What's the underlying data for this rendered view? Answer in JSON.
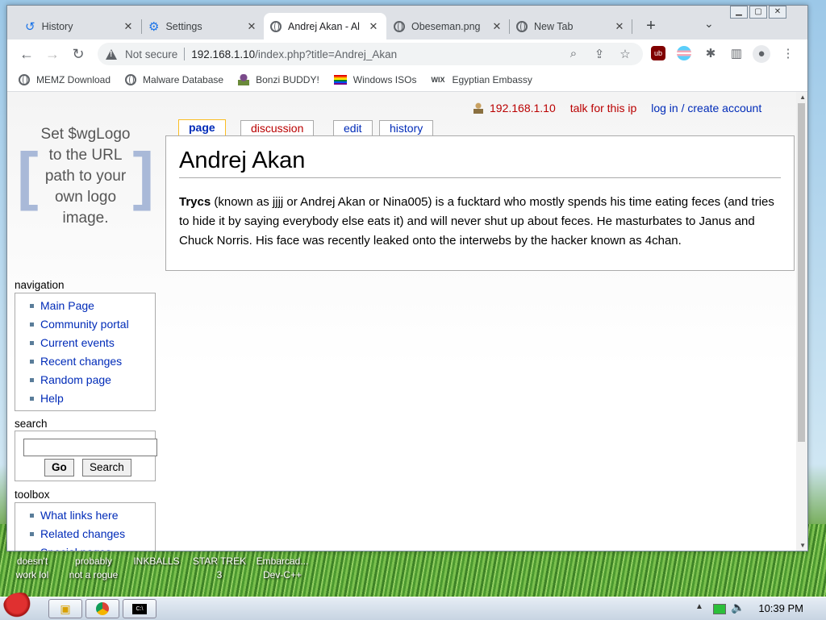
{
  "desktop": {
    "icons": [
      {
        "label_line1": "doesn't",
        "label_line2": "work lol"
      },
      {
        "label_line1": "probably",
        "label_line2": "not a rogue"
      },
      {
        "label_line1": "INKBALLS",
        "label_line2": ""
      },
      {
        "label_line1": "STAR TREK",
        "label_line2": "3"
      },
      {
        "label_line1": "Embarcad...",
        "label_line2": "Dev-C++"
      }
    ]
  },
  "browser": {
    "tabs": [
      {
        "title": "History",
        "icon": "history-icon"
      },
      {
        "title": "Settings",
        "icon": "gear-icon"
      },
      {
        "title": "Andrej Akan - Al",
        "icon": "globe-icon"
      },
      {
        "title": "Obeseman.png",
        "icon": "globe-icon"
      },
      {
        "title": "New Tab",
        "icon": "chrome-icon"
      }
    ],
    "security_label": "Not secure",
    "url_host": "192.168.1.10",
    "url_path": "/index.php?title=Andrej_Akan",
    "bookmarks": [
      {
        "label": "MEMZ Download",
        "icon": "globe-icon"
      },
      {
        "label": "Malware Database",
        "icon": "globe-icon"
      },
      {
        "label": "Bonzi BUDDY!",
        "icon": "bonzi-icon"
      },
      {
        "label": "Windows ISOs",
        "icon": "rainbow-flag-icon"
      },
      {
        "label": "Egyptian Embassy",
        "icon": "wix-icon"
      }
    ]
  },
  "wiki": {
    "personal": {
      "ip": "192.168.1.10",
      "talk": "talk for this ip",
      "login": "log in / create account"
    },
    "logo_text": [
      "Set $wgLogo",
      "to the URL",
      "path to your",
      "own logo",
      "image."
    ],
    "tabs": {
      "page": "page",
      "discussion": "discussion",
      "edit": "edit",
      "history": "history"
    },
    "title": "Andrej Akan",
    "body_bold": "Trycs",
    "body_text": " (known as jjjj or Andrej Akan or Nina005) is a fucktard who mostly spends his time eating feces (and tries to hide it by saying everybody else eats it) and will never shut up about feces. He masturbates to Janus and Chuck Norris. His face was recently leaked onto the interwebs by the hacker known as 4chan.",
    "navigation": {
      "heading": "navigation",
      "items": [
        "Main Page",
        "Community portal",
        "Current events",
        "Recent changes",
        "Random page",
        "Help"
      ]
    },
    "search": {
      "heading": "search",
      "go_label": "Go",
      "search_label": "Search",
      "value": ""
    },
    "toolbox": {
      "heading": "toolbox",
      "items": [
        "What links here",
        "Related changes",
        "Special pages"
      ]
    }
  },
  "taskbar": {
    "clock": "10:39 PM"
  }
}
